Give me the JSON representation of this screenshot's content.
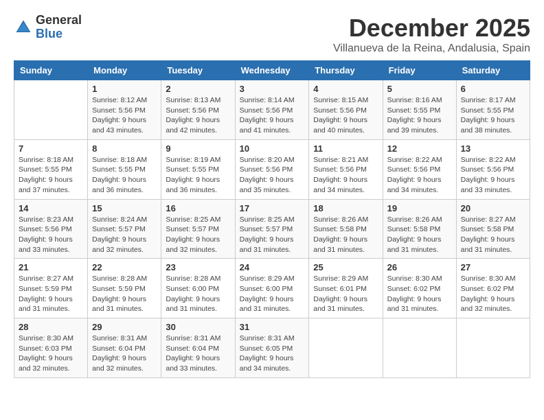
{
  "logo": {
    "general": "General",
    "blue": "Blue"
  },
  "title": {
    "month": "December 2025",
    "location": "Villanueva de la Reina, Andalusia, Spain"
  },
  "headers": [
    "Sunday",
    "Monday",
    "Tuesday",
    "Wednesday",
    "Thursday",
    "Friday",
    "Saturday"
  ],
  "weeks": [
    [
      {
        "day": "",
        "sunrise": "",
        "sunset": "",
        "daylight": ""
      },
      {
        "day": "1",
        "sunrise": "Sunrise: 8:12 AM",
        "sunset": "Sunset: 5:56 PM",
        "daylight": "Daylight: 9 hours and 43 minutes."
      },
      {
        "day": "2",
        "sunrise": "Sunrise: 8:13 AM",
        "sunset": "Sunset: 5:56 PM",
        "daylight": "Daylight: 9 hours and 42 minutes."
      },
      {
        "day": "3",
        "sunrise": "Sunrise: 8:14 AM",
        "sunset": "Sunset: 5:56 PM",
        "daylight": "Daylight: 9 hours and 41 minutes."
      },
      {
        "day": "4",
        "sunrise": "Sunrise: 8:15 AM",
        "sunset": "Sunset: 5:56 PM",
        "daylight": "Daylight: 9 hours and 40 minutes."
      },
      {
        "day": "5",
        "sunrise": "Sunrise: 8:16 AM",
        "sunset": "Sunset: 5:55 PM",
        "daylight": "Daylight: 9 hours and 39 minutes."
      },
      {
        "day": "6",
        "sunrise": "Sunrise: 8:17 AM",
        "sunset": "Sunset: 5:55 PM",
        "daylight": "Daylight: 9 hours and 38 minutes."
      }
    ],
    [
      {
        "day": "7",
        "sunrise": "Sunrise: 8:18 AM",
        "sunset": "Sunset: 5:55 PM",
        "daylight": "Daylight: 9 hours and 37 minutes."
      },
      {
        "day": "8",
        "sunrise": "Sunrise: 8:18 AM",
        "sunset": "Sunset: 5:55 PM",
        "daylight": "Daylight: 9 hours and 36 minutes."
      },
      {
        "day": "9",
        "sunrise": "Sunrise: 8:19 AM",
        "sunset": "Sunset: 5:55 PM",
        "daylight": "Daylight: 9 hours and 36 minutes."
      },
      {
        "day": "10",
        "sunrise": "Sunrise: 8:20 AM",
        "sunset": "Sunset: 5:56 PM",
        "daylight": "Daylight: 9 hours and 35 minutes."
      },
      {
        "day": "11",
        "sunrise": "Sunrise: 8:21 AM",
        "sunset": "Sunset: 5:56 PM",
        "daylight": "Daylight: 9 hours and 34 minutes."
      },
      {
        "day": "12",
        "sunrise": "Sunrise: 8:22 AM",
        "sunset": "Sunset: 5:56 PM",
        "daylight": "Daylight: 9 hours and 34 minutes."
      },
      {
        "day": "13",
        "sunrise": "Sunrise: 8:22 AM",
        "sunset": "Sunset: 5:56 PM",
        "daylight": "Daylight: 9 hours and 33 minutes."
      }
    ],
    [
      {
        "day": "14",
        "sunrise": "Sunrise: 8:23 AM",
        "sunset": "Sunset: 5:56 PM",
        "daylight": "Daylight: 9 hours and 33 minutes."
      },
      {
        "day": "15",
        "sunrise": "Sunrise: 8:24 AM",
        "sunset": "Sunset: 5:57 PM",
        "daylight": "Daylight: 9 hours and 32 minutes."
      },
      {
        "day": "16",
        "sunrise": "Sunrise: 8:25 AM",
        "sunset": "Sunset: 5:57 PM",
        "daylight": "Daylight: 9 hours and 32 minutes."
      },
      {
        "day": "17",
        "sunrise": "Sunrise: 8:25 AM",
        "sunset": "Sunset: 5:57 PM",
        "daylight": "Daylight: 9 hours and 31 minutes."
      },
      {
        "day": "18",
        "sunrise": "Sunrise: 8:26 AM",
        "sunset": "Sunset: 5:58 PM",
        "daylight": "Daylight: 9 hours and 31 minutes."
      },
      {
        "day": "19",
        "sunrise": "Sunrise: 8:26 AM",
        "sunset": "Sunset: 5:58 PM",
        "daylight": "Daylight: 9 hours and 31 minutes."
      },
      {
        "day": "20",
        "sunrise": "Sunrise: 8:27 AM",
        "sunset": "Sunset: 5:58 PM",
        "daylight": "Daylight: 9 hours and 31 minutes."
      }
    ],
    [
      {
        "day": "21",
        "sunrise": "Sunrise: 8:27 AM",
        "sunset": "Sunset: 5:59 PM",
        "daylight": "Daylight: 9 hours and 31 minutes."
      },
      {
        "day": "22",
        "sunrise": "Sunrise: 8:28 AM",
        "sunset": "Sunset: 5:59 PM",
        "daylight": "Daylight: 9 hours and 31 minutes."
      },
      {
        "day": "23",
        "sunrise": "Sunrise: 8:28 AM",
        "sunset": "Sunset: 6:00 PM",
        "daylight": "Daylight: 9 hours and 31 minutes."
      },
      {
        "day": "24",
        "sunrise": "Sunrise: 8:29 AM",
        "sunset": "Sunset: 6:00 PM",
        "daylight": "Daylight: 9 hours and 31 minutes."
      },
      {
        "day": "25",
        "sunrise": "Sunrise: 8:29 AM",
        "sunset": "Sunset: 6:01 PM",
        "daylight": "Daylight: 9 hours and 31 minutes."
      },
      {
        "day": "26",
        "sunrise": "Sunrise: 8:30 AM",
        "sunset": "Sunset: 6:02 PM",
        "daylight": "Daylight: 9 hours and 31 minutes."
      },
      {
        "day": "27",
        "sunrise": "Sunrise: 8:30 AM",
        "sunset": "Sunset: 6:02 PM",
        "daylight": "Daylight: 9 hours and 32 minutes."
      }
    ],
    [
      {
        "day": "28",
        "sunrise": "Sunrise: 8:30 AM",
        "sunset": "Sunset: 6:03 PM",
        "daylight": "Daylight: 9 hours and 32 minutes."
      },
      {
        "day": "29",
        "sunrise": "Sunrise: 8:31 AM",
        "sunset": "Sunset: 6:04 PM",
        "daylight": "Daylight: 9 hours and 32 minutes."
      },
      {
        "day": "30",
        "sunrise": "Sunrise: 8:31 AM",
        "sunset": "Sunset: 6:04 PM",
        "daylight": "Daylight: 9 hours and 33 minutes."
      },
      {
        "day": "31",
        "sunrise": "Sunrise: 8:31 AM",
        "sunset": "Sunset: 6:05 PM",
        "daylight": "Daylight: 9 hours and 34 minutes."
      },
      {
        "day": "",
        "sunrise": "",
        "sunset": "",
        "daylight": ""
      },
      {
        "day": "",
        "sunrise": "",
        "sunset": "",
        "daylight": ""
      },
      {
        "day": "",
        "sunrise": "",
        "sunset": "",
        "daylight": ""
      }
    ]
  ]
}
